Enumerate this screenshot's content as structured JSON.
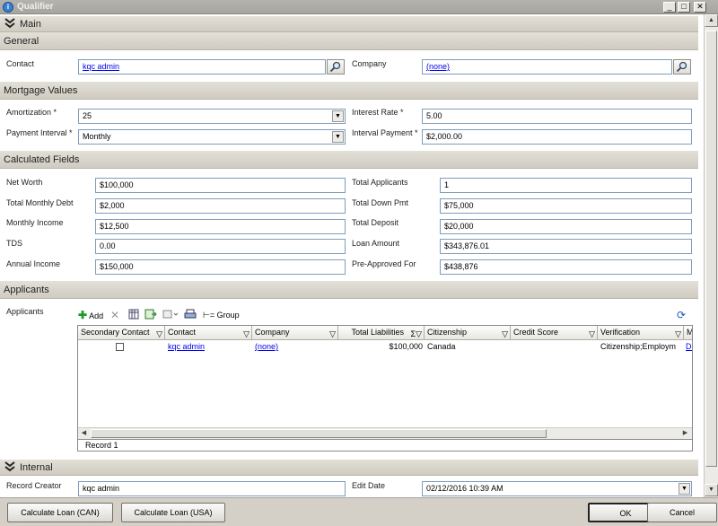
{
  "window": {
    "title": "Qualifier",
    "min": "_",
    "max": "□",
    "close": "✕"
  },
  "sections": {
    "main": "Main",
    "general": "General",
    "mortgage": "Mortgage Values",
    "calculated": "Calculated Fields",
    "applicants": "Applicants",
    "internal": "Internal"
  },
  "general": {
    "contact_label": "Contact",
    "contact_value": "kqc admin",
    "company_label": "Company",
    "company_value": "(none)"
  },
  "mortgage": {
    "amortization_label": "Amortization *",
    "amortization_value": "25",
    "interest_label": "Interest Rate *",
    "interest_value": "5.00",
    "payment_interval_label": "Payment Interval *",
    "payment_interval_value": "Monthly",
    "interval_payment_label": "Interval Payment *",
    "interval_payment_value": "$2,000.00"
  },
  "calc": {
    "net_worth_label": "Net Worth",
    "net_worth": "$100,000",
    "total_applicants_label": "Total Applicants",
    "total_applicants": "1",
    "total_monthly_debt_label": "Total Monthly Debt",
    "total_monthly_debt": "$2,000",
    "total_down_pmt_label": "Total Down Pmt",
    "total_down_pmt": "$75,000",
    "monthly_income_label": "Monthly Income",
    "monthly_income": "$12,500",
    "total_deposit_label": "Total Deposit",
    "total_deposit": "$20,000",
    "tds_label": "TDS",
    "tds": "0.00",
    "loan_amount_label": "Loan Amount",
    "loan_amount": "$343,876.01",
    "annual_income_label": "Annual Income",
    "annual_income": "$150,000",
    "pre_approved_label": "Pre-Approved For",
    "pre_approved": "$438,876"
  },
  "applicants": {
    "label": "Applicants",
    "toolbar": {
      "add": "Add",
      "group": "Group"
    },
    "columns": [
      "Secondary Contact",
      "Contact",
      "Company",
      "Total Liabilities",
      "Citizenship",
      "Credit Score",
      "Verification",
      "M"
    ],
    "row": {
      "contact": "kqc admin",
      "company": "(none)",
      "total_liabilities": "$100,000",
      "citizenship": "Canada",
      "credit_score": "",
      "verification": "Citizenship;Employm",
      "m": "De"
    },
    "record_text": "Record 1"
  },
  "internal": {
    "record_creator_label": "Record Creator",
    "record_creator": "kqc admin",
    "edit_date_label": "Edit Date",
    "edit_date": "02/12/2016 10:39 AM"
  },
  "footer": {
    "calc_can": "Calculate Loan (CAN)",
    "calc_usa": "Calculate Loan (USA)",
    "ok": "OK",
    "cancel": "Cancel"
  }
}
